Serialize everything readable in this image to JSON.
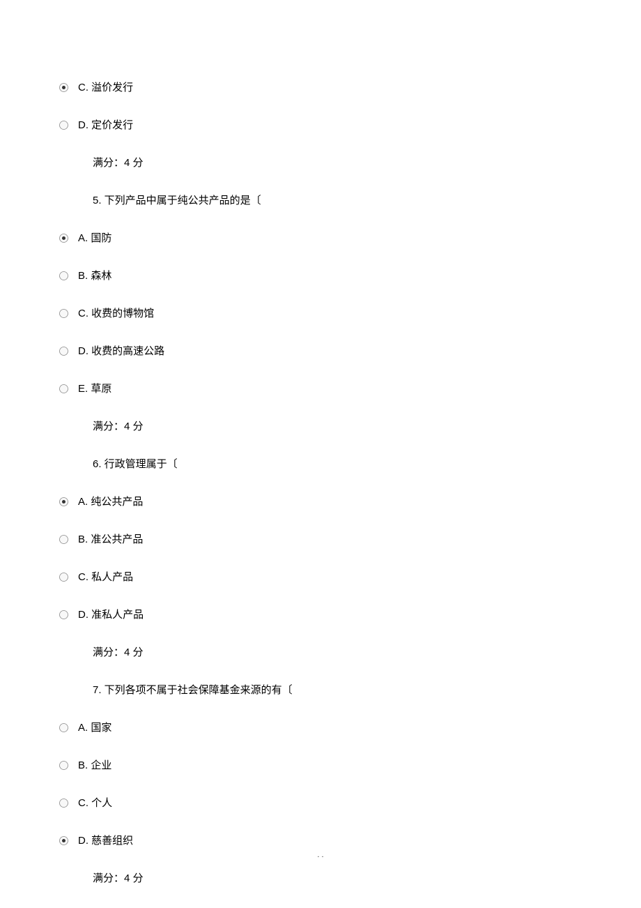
{
  "q4": {
    "option_c": "C. 溢价发行",
    "option_d": "D. 定价发行",
    "score": "满分：4 分"
  },
  "q5": {
    "prompt": "5.  下列产品中属于纯公共产品的是〔",
    "option_a": "A. 国防",
    "option_b": "B. 森林",
    "option_c": "C. 收费的博物馆",
    "option_d": "D. 收费的高速公路",
    "option_e": "E. 草原",
    "score": "满分：4 分"
  },
  "q6": {
    "prompt": "6. 行政管理属于〔",
    "option_a": "A. 纯公共产品",
    "option_b": "B. 准公共产品",
    "option_c": "C. 私人产品",
    "option_d": "D. 准私人产品",
    "score": "满分：4 分"
  },
  "q7": {
    "prompt": "7.  下列各项不属于社会保障基金来源的有〔",
    "option_a": "A. 国家",
    "option_b": "B. 企业",
    "option_c": "C. 个人",
    "option_d": "D. 慈善组织",
    "score": "满分：4 分"
  },
  "footer": ".    ."
}
